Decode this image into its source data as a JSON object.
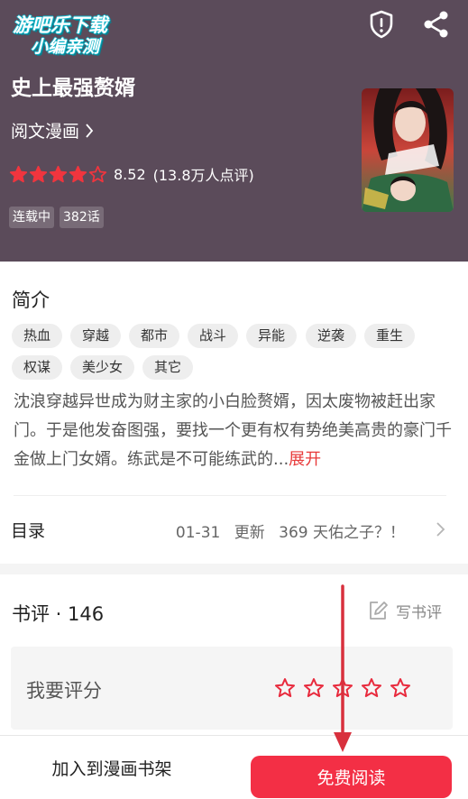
{
  "watermark": {
    "line1": "游吧乐下载",
    "line2": "小编亲测"
  },
  "header": {
    "bg_color": "#5b4b5a",
    "icons": [
      "alert-shield-icon",
      "share-icon"
    ]
  },
  "book": {
    "title": "史上最强赘婿",
    "publisher": "阅文漫画",
    "rating_stars": 4,
    "rating_stars_max": 5,
    "score": "8.52",
    "rating_count": "(13.8万人点评)",
    "status_badge": "连载中",
    "episodes_badge": "382话"
  },
  "intro": {
    "heading": "简介",
    "tags": [
      "热血",
      "穿越",
      "都市",
      "战斗",
      "异能",
      "逆袭",
      "重生",
      "权谋",
      "美少女",
      "其它"
    ],
    "synopsis": "沈浪穿越异世成为财主家的小白脸赘婿，因太废物被赶出家门。于是他发奋图强，要找一个更有权有势绝美高贵的豪门千金做上门女婿。练武是不可能练武的...",
    "expand_label": "展开"
  },
  "toc": {
    "label": "目录",
    "latest_date": "01-31",
    "latest_update": "更新",
    "latest_chapter": "369 天佑之子？！"
  },
  "reviews": {
    "heading": "书评 · 146",
    "write_label": "写书评",
    "rate_label": "我要评分",
    "rate_star_count": 5
  },
  "bottom_bar": {
    "add_shelf_label": "加入到漫画书架",
    "read_label": "免费阅读",
    "accent": "#f32f45"
  },
  "annotation": {
    "arrow_color": "#d8303d"
  }
}
